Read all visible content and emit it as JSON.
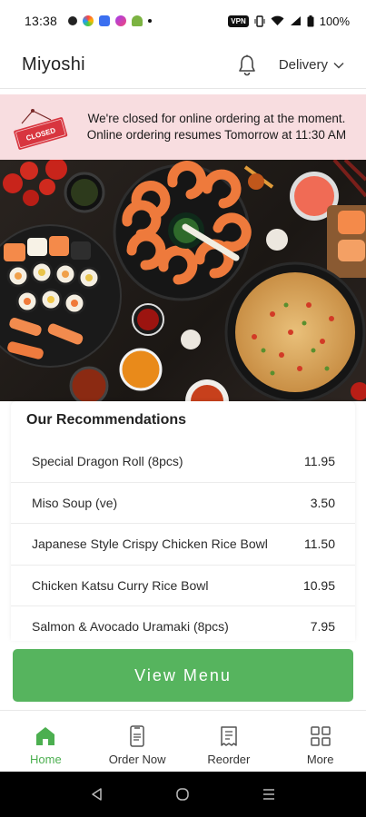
{
  "status_bar": {
    "time": "13:38",
    "vpn": "VPN",
    "battery": "100%"
  },
  "header": {
    "brand": "Miyoshi",
    "delivery_label": "Delivery"
  },
  "banner": {
    "sign_text": "CLOSED",
    "line1": "We're closed for online ordering at the moment.",
    "line2": "Online ordering resumes Tomorrow at 11:30 AM"
  },
  "recommendations": {
    "title": "Our Recommendations",
    "items": [
      {
        "name": "Special Dragon Roll (8pcs)",
        "price": "11.95"
      },
      {
        "name": "Miso Soup (ve)",
        "price": "3.50"
      },
      {
        "name": "Japanese Style Crispy Chicken Rice Bowl",
        "price": "11.50"
      },
      {
        "name": "Chicken Katsu Curry Rice Bowl",
        "price": "10.95"
      },
      {
        "name": "Salmon & Avocado Uramaki (8pcs)",
        "price": "7.95"
      }
    ]
  },
  "view_menu_label": "View Menu",
  "bottom_nav": [
    {
      "label": "Home",
      "icon": "home-icon",
      "active": true
    },
    {
      "label": "Order Now",
      "icon": "order-icon",
      "active": false
    },
    {
      "label": "Reorder",
      "icon": "receipt-icon",
      "active": false
    },
    {
      "label": "More",
      "icon": "grid-icon",
      "active": false
    }
  ],
  "colors": {
    "accent": "#56b45e",
    "active_nav": "#4caf50",
    "banner_bg": "#f8dde0",
    "closed_sign": "#d8353f"
  }
}
